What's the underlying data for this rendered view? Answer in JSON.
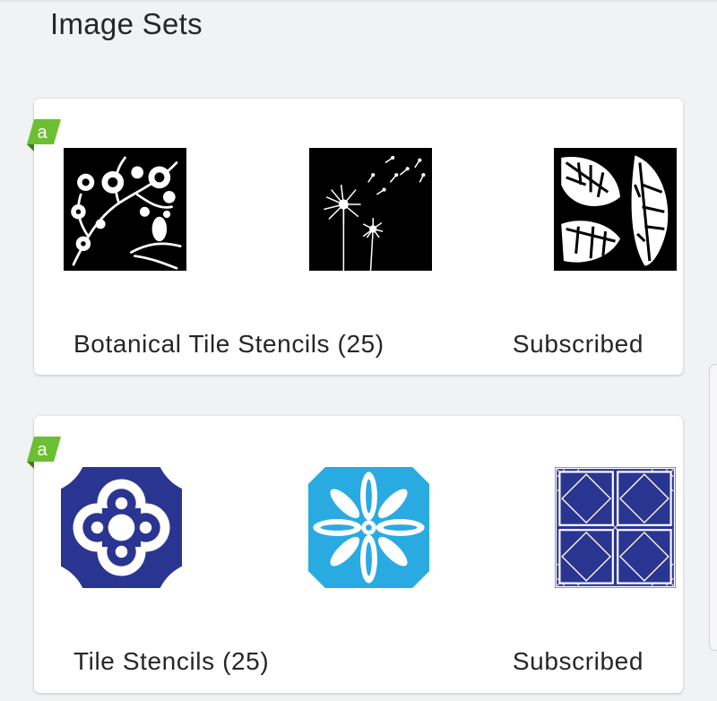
{
  "page": {
    "title": "Image Sets"
  },
  "image_sets": [
    {
      "title": "Botanical Tile Stencils (25)",
      "status": "Subscribed",
      "badge_icon": "access-badge-icon",
      "badge_letter": "a",
      "badge_color": "#6cbf33",
      "thumbnails": [
        "chinoiserie-peacock-stencil",
        "dandelion-stencil",
        "monstera-leaf-stencil"
      ]
    },
    {
      "title": "Tile Stencils (25)",
      "status": "Subscribed",
      "badge_icon": "access-badge-icon",
      "badge_letter": "a",
      "badge_color": "#6cbf33",
      "thumbnails": [
        "quatrefoil-tile-stencil",
        "floral-medallion-tile-stencil",
        "diamond-grid-tile-stencil"
      ]
    }
  ],
  "colors": {
    "stencil_black": "#000000",
    "navy_tile": "#2a3592",
    "sky_tile": "#29aae1",
    "badge_green": "#6cbf33"
  }
}
